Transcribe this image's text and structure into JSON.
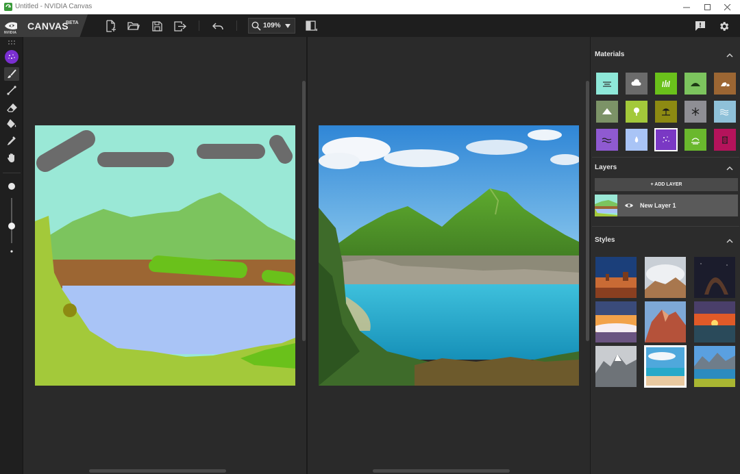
{
  "window": {
    "title": "Untitled - NVIDIA Canvas",
    "controls": [
      "minimize-icon",
      "maximize-icon",
      "close-icon"
    ]
  },
  "brand": {
    "logo_text": "NVIDIA",
    "name": "CANVAS",
    "tag": "BETA"
  },
  "toolbar": {
    "zoom_value": "109%",
    "buttons": [
      "new-file-icon",
      "open-folder-icon",
      "save-icon",
      "export-icon",
      "undo-icon",
      "search-icon",
      "chevron-down-icon",
      "compare-view-icon",
      "feedback-icon",
      "gear-icon"
    ]
  },
  "left_tools": [
    "material-picker-icon",
    "brush-icon",
    "line-icon",
    "eraser-icon",
    "fill-bucket-icon",
    "eyedropper-icon",
    "hand-icon"
  ],
  "brush_size": {
    "level": 0.5
  },
  "panel": {
    "materials_title": "Materials",
    "layers_title": "Layers",
    "add_layer_label": "+ ADD LAYER",
    "layer_name": "New Layer 1",
    "styles_title": "Styles"
  },
  "materials": [
    {
      "name": "fog-material",
      "color": "#8ee8d8"
    },
    {
      "name": "cloud-material",
      "color": "#6b6b6b"
    },
    {
      "name": "grass-material",
      "color": "#6ac11b"
    },
    {
      "name": "hill-material",
      "color": "#7cc45e"
    },
    {
      "name": "rock-material",
      "color": "#9c6633"
    },
    {
      "name": "mountain-material",
      "color": "#7c9367"
    },
    {
      "name": "tree-material",
      "color": "#a3c93a"
    },
    {
      "name": "beach-material",
      "color": "#8d8a12"
    },
    {
      "name": "snow-material",
      "color": "#8e8e94"
    },
    {
      "name": "water-material",
      "color": "#8fc1d9"
    },
    {
      "name": "river-material",
      "color": "#8f5ad1"
    },
    {
      "name": "lake-material",
      "color": "#a9c4f6"
    },
    {
      "name": "sky-material",
      "color": "#7a38c4",
      "selected": true
    },
    {
      "name": "sea-material",
      "color": "#6ab82d"
    },
    {
      "name": "building-material",
      "color": "#b5135b"
    }
  ],
  "styles": [
    {
      "name": "style-desert-valley"
    },
    {
      "name": "style-cloud-peaks"
    },
    {
      "name": "style-night-arch"
    },
    {
      "name": "style-sunset-sea-fog"
    },
    {
      "name": "style-red-rocks"
    },
    {
      "name": "style-ocean-sunset"
    },
    {
      "name": "style-snow-mountain"
    },
    {
      "name": "style-tropical-beach",
      "selected": true
    },
    {
      "name": "style-alpine-lake"
    }
  ],
  "colors": {
    "accent_purple": "#7a2fd1",
    "nvidia_green": "#76b900"
  }
}
